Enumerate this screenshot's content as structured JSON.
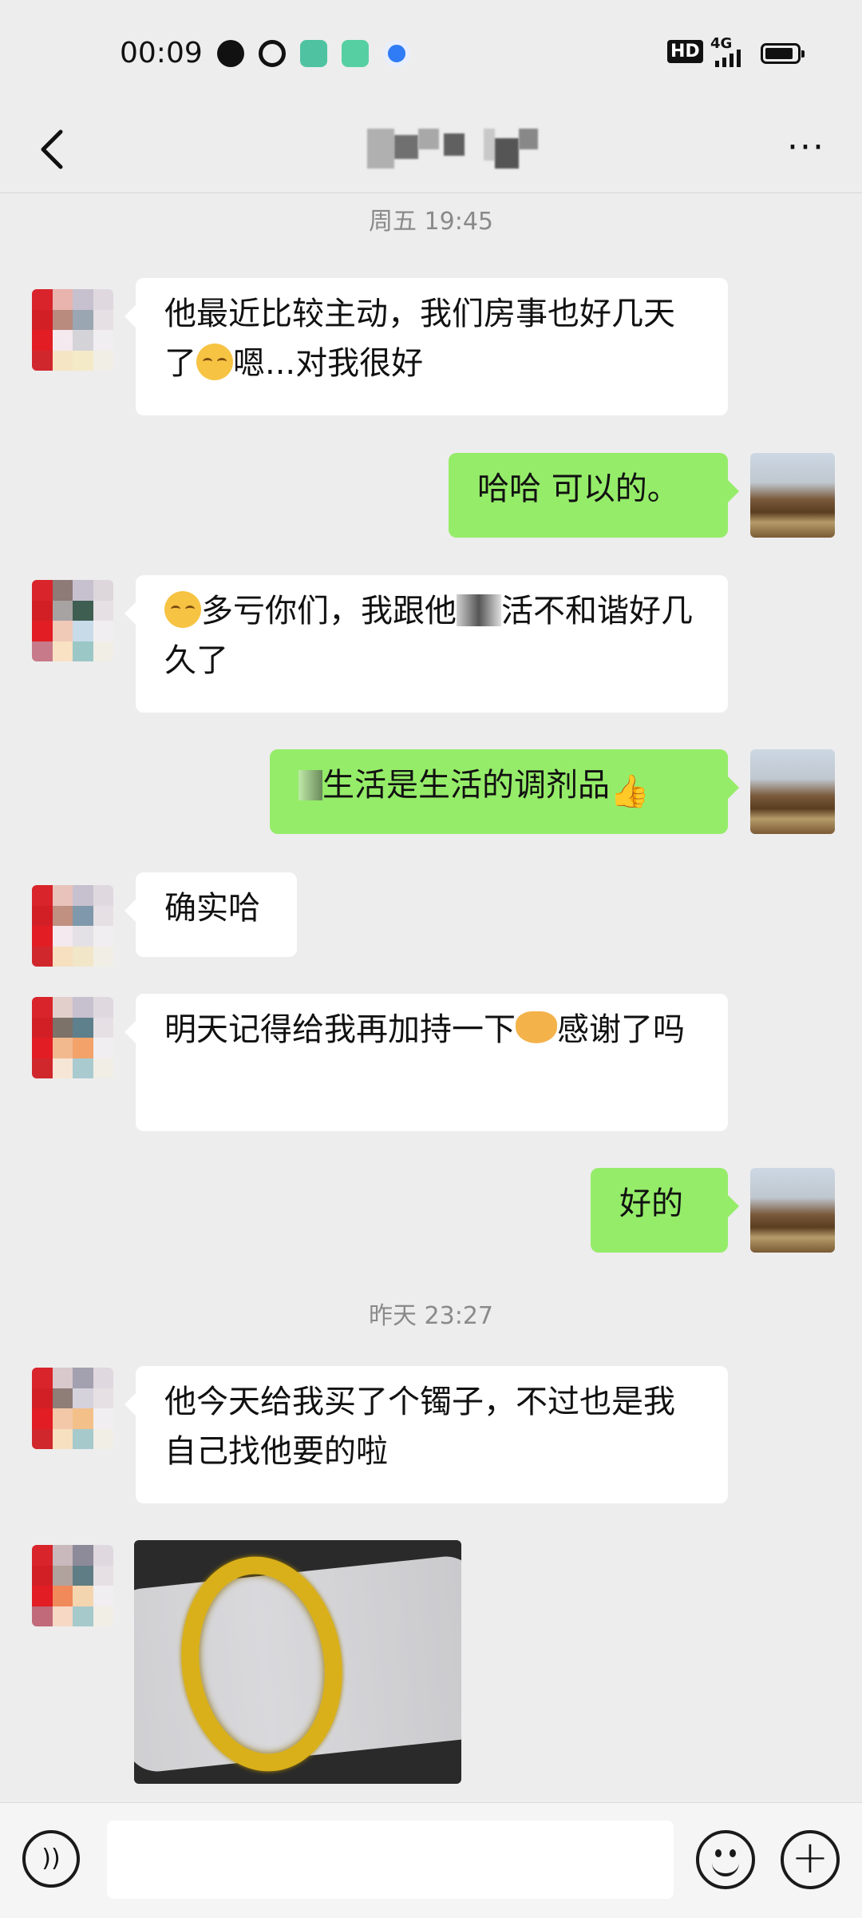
{
  "status_bar": {
    "time": "00:09",
    "hd_label": "HD",
    "network_label": "4G"
  },
  "header": {
    "back_icon": "chevron-left-icon",
    "more_label": "···"
  },
  "messages": {
    "ts1": "周五 19:45",
    "m1": "他最近比较主动，我们房事也好几天了",
    "m1_tail": "嗯...对我很好",
    "m2": "哈哈 可以的。",
    "m3_head": "多亏你们，我跟他",
    "m3_tail": "活不和谐好几久了",
    "m4": "生活是生活的调剂品",
    "m5": "确实哈",
    "m6_head": "明天记得给我再加持一下",
    "m6_tail": "感谢了吗",
    "m7": "好的",
    "ts2": "昨天 23:27",
    "m8": "他今天给我买了个镯子，不过也是我自己找他要的啦"
  },
  "bottom_bar": {
    "voice_icon": "voice-icon",
    "emoji_icon": "emoji-icon",
    "plus_label": "+"
  },
  "colors": {
    "background": "#ededed",
    "incoming_bubble": "#ffffff",
    "outgoing_bubble": "#95ec69",
    "timestamp": "#8a8a8a"
  }
}
